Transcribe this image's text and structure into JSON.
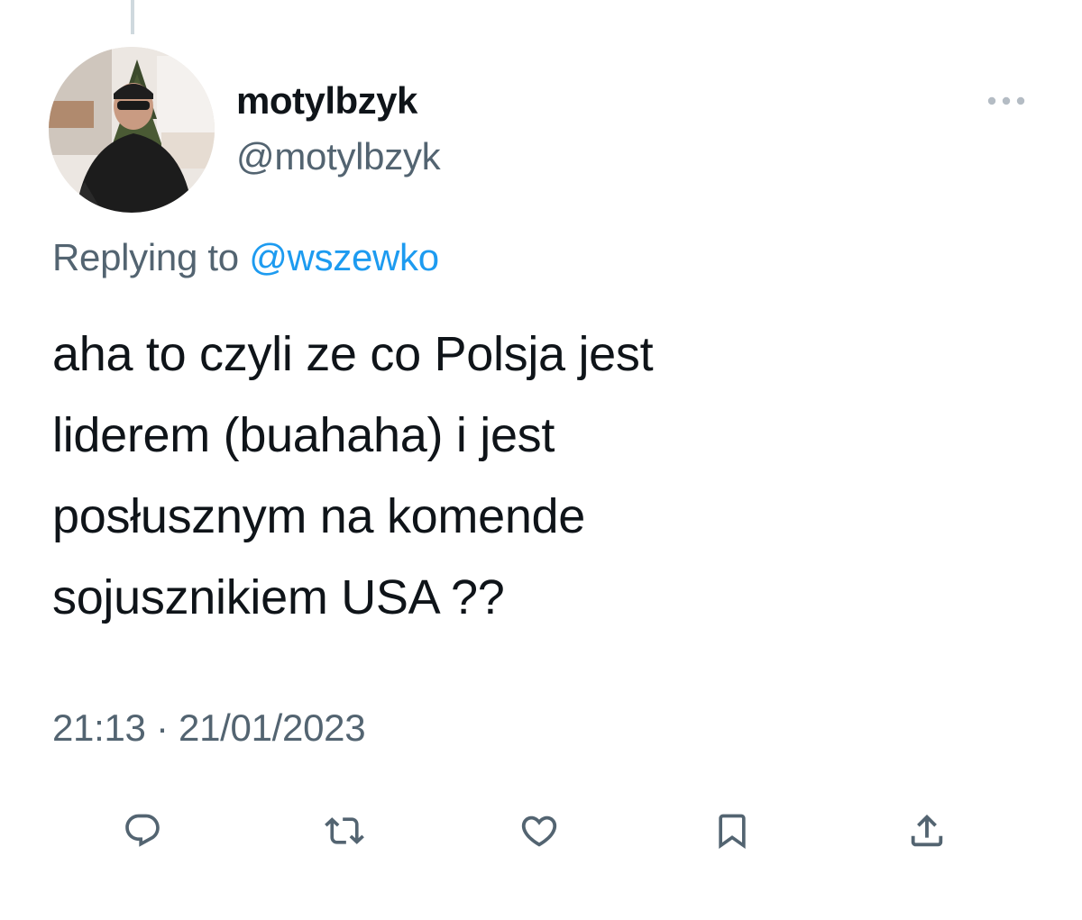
{
  "tweet": {
    "display_name": "motylbzyk",
    "handle": "@motylbzyk",
    "replying_prefix": "Replying to",
    "replying_to": "@wszewko",
    "text_lines": [
      "aha to czyli ze co Polsja jest",
      "liderem (buahaha) i jest",
      "posłusznym na komende",
      "sojusznikiem USA ??"
    ],
    "time": "21:13",
    "separator": "·",
    "date": "21/01/2023"
  },
  "actions": [
    {
      "icon": "reply-icon"
    },
    {
      "icon": "retweet-icon"
    },
    {
      "icon": "like-icon"
    },
    {
      "icon": "bookmark-icon"
    },
    {
      "icon": "share-icon"
    }
  ],
  "colors": {
    "text_primary": "#0f1419",
    "text_secondary": "#536471",
    "link": "#1d9bf0",
    "icon": "#536471",
    "thread_line": "#cfd9de"
  }
}
